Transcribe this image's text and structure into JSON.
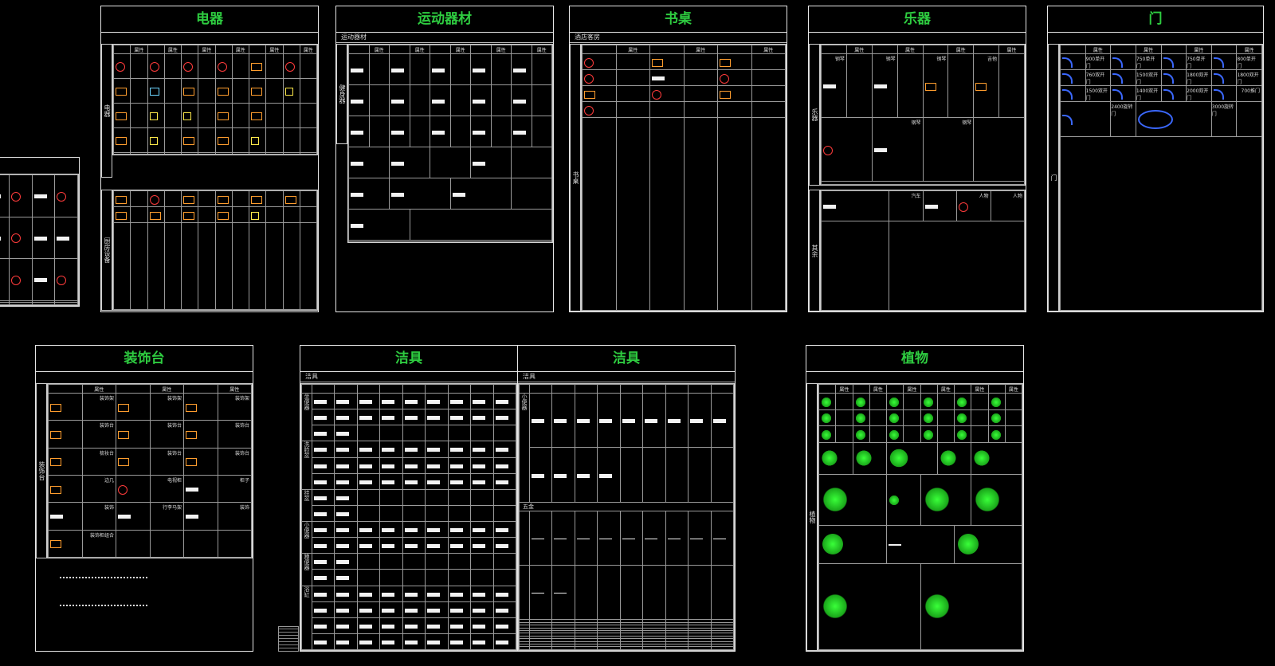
{
  "sheets": {
    "dianqi": {
      "title": "电器",
      "side1": "电器",
      "side2": "厨房设备"
    },
    "yundong": {
      "title": "运动器材",
      "sub": "运动器材",
      "side": "健身器"
    },
    "shuzhuo": {
      "title": "书桌",
      "sub": "酒店客房",
      "side": "书桌"
    },
    "yueqi": {
      "title": "乐器",
      "side1": "乐器",
      "side2": "其余",
      "labels": [
        "钢琴",
        "钢琴",
        "钢琴",
        "吉他",
        "钢琴",
        "钢琴",
        "汽车",
        "人物",
        "人物"
      ]
    },
    "men": {
      "title": "门",
      "side": "门",
      "labels": [
        "900单开门",
        "750单开门",
        "750单开门",
        "800单开门",
        "760双开门",
        "1500双开门",
        "1800双开门",
        "1800双开门",
        "1500双开门",
        "1400双开门",
        "2000双开门",
        "700推门",
        "2400旋转门",
        "3000旋转门"
      ]
    },
    "zhuangshi": {
      "title": "装饰台",
      "side": "装饰台",
      "labels": [
        "装饰架",
        "装饰架",
        "装饰架",
        "装饰台",
        "装饰台",
        "装饰台",
        "梳妆台",
        "装饰台",
        "装饰台",
        "边几",
        "电视柜",
        "柜子",
        "装饰",
        "行李马架",
        "装饰",
        "装饰柜组合"
      ]
    },
    "jieju1": {
      "title": "洁具",
      "sub": "洁具",
      "sides": [
        "坐便器",
        "洗脸盆",
        "挂盆",
        "小便器",
        "蹲便器",
        "浴缸"
      ]
    },
    "jieju2": {
      "title": "洁具",
      "sub": "洁具",
      "side1": "小便器",
      "side2": "五金"
    },
    "zhiwu": {
      "title": "植物",
      "side": "植物"
    }
  },
  "header_label": "属性",
  "colors": {
    "title": "#2ecc40",
    "line": "#e6e6e6",
    "bg": "#000000"
  }
}
